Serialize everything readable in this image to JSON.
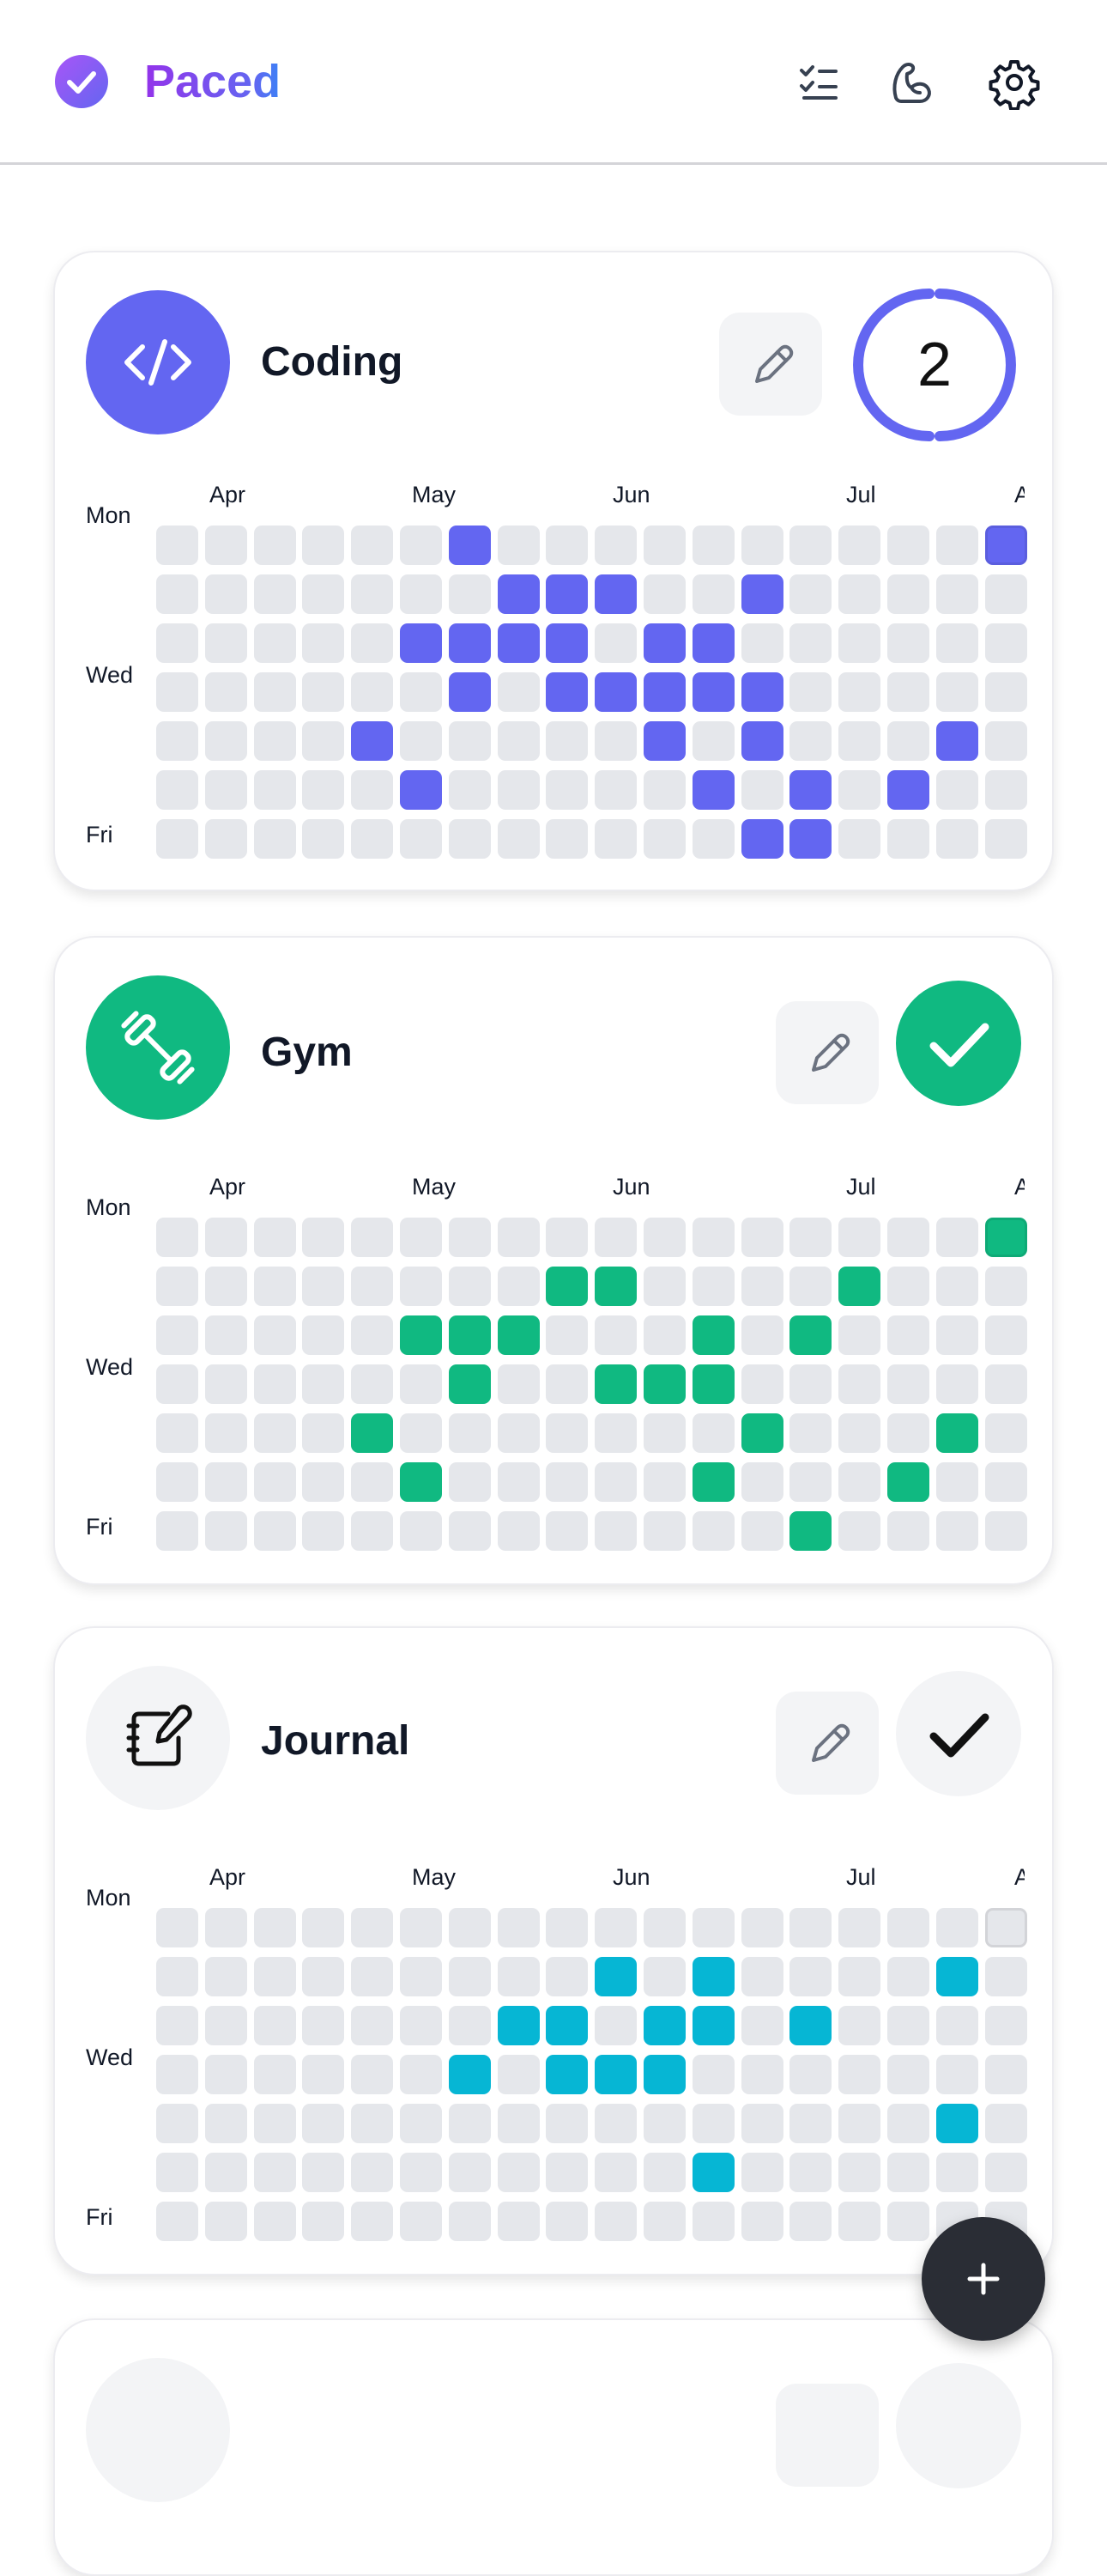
{
  "app": {
    "title": "Paced",
    "logo_icon": "check-circle-icon",
    "header_icons": [
      "checklist-icon",
      "flexed-arm-icon",
      "gear-icon"
    ]
  },
  "months": [
    "Apr",
    "May",
    "Jun",
    "Jul",
    "Au"
  ],
  "day_labels": [
    "Mon",
    "Wed",
    "Fri"
  ],
  "grid": {
    "weeks": 18,
    "days_per_week": 7
  },
  "empty_color": "#e5e7eb",
  "habits": [
    {
      "name": "Coding",
      "icon": "code-icon",
      "color": "#6366f1",
      "status": "count",
      "count": "2",
      "edit_icon": "pencil-icon",
      "completed": [
        [
          0,
          6
        ],
        [
          0,
          17
        ],
        [
          1,
          7
        ],
        [
          1,
          8
        ],
        [
          1,
          9
        ],
        [
          1,
          12
        ],
        [
          2,
          5
        ],
        [
          2,
          6
        ],
        [
          2,
          7
        ],
        [
          2,
          8
        ],
        [
          2,
          10
        ],
        [
          2,
          11
        ],
        [
          3,
          6
        ],
        [
          3,
          8
        ],
        [
          3,
          9
        ],
        [
          3,
          10
        ],
        [
          3,
          11
        ],
        [
          3,
          12
        ],
        [
          4,
          4
        ],
        [
          4,
          10
        ],
        [
          4,
          12
        ],
        [
          4,
          16
        ],
        [
          5,
          5
        ],
        [
          5,
          11
        ],
        [
          5,
          13
        ],
        [
          5,
          15
        ],
        [
          6,
          12
        ],
        [
          6,
          13
        ]
      ]
    },
    {
      "name": "Gym",
      "icon": "dumbbell-icon",
      "color": "#10b981",
      "status": "done",
      "edit_icon": "pencil-icon",
      "completed": [
        [
          0,
          17
        ],
        [
          1,
          8
        ],
        [
          1,
          9
        ],
        [
          1,
          14
        ],
        [
          2,
          5
        ],
        [
          2,
          6
        ],
        [
          2,
          7
        ],
        [
          2,
          11
        ],
        [
          2,
          13
        ],
        [
          3,
          6
        ],
        [
          3,
          9
        ],
        [
          3,
          10
        ],
        [
          3,
          11
        ],
        [
          4,
          4
        ],
        [
          4,
          12
        ],
        [
          4,
          16
        ],
        [
          5,
          5
        ],
        [
          5,
          11
        ],
        [
          5,
          15
        ],
        [
          6,
          13
        ]
      ]
    },
    {
      "name": "Journal",
      "icon": "notebook-pen-icon",
      "color": "#06b6d4",
      "status": "not-done",
      "edit_icon": "pencil-icon",
      "completed": [
        [
          1,
          9
        ],
        [
          1,
          11
        ],
        [
          1,
          16
        ],
        [
          2,
          7
        ],
        [
          2,
          8
        ],
        [
          2,
          10
        ],
        [
          2,
          11
        ],
        [
          2,
          13
        ],
        [
          3,
          6
        ],
        [
          3,
          8
        ],
        [
          3,
          9
        ],
        [
          3,
          10
        ],
        [
          4,
          16
        ],
        [
          5,
          11
        ]
      ]
    }
  ],
  "fab": {
    "icon": "plus-icon"
  }
}
